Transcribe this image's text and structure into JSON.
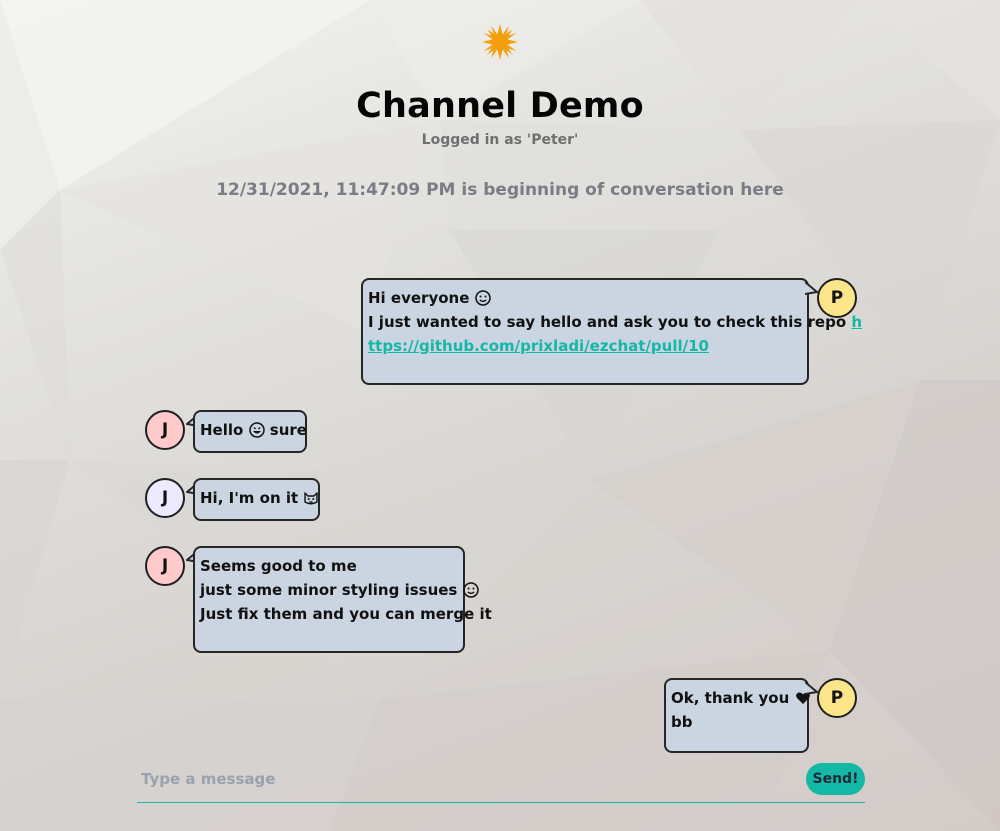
{
  "header": {
    "title": "Channel Demo",
    "logged_in_text": "Logged in as 'Peter'",
    "conversation_start": "12/31/2021, 11:47:09 PM is beginning of conversation here"
  },
  "messages": [
    {
      "side": "right",
      "avatar_initial": "P",
      "avatar_color": "#fde68a",
      "lines": [
        "Hi everyone",
        "I just wanted to say hello and ask you to check this repo",
        "ttps://github.com/prixladi/ezchat/pull/10"
      ],
      "link_prefix": "h",
      "link_text": "ttps://github.com/prixladi/ezchat/pull/10"
    },
    {
      "side": "left",
      "avatar_initial": "J",
      "avatar_color": "#fecaca",
      "lines": [
        "Hello",
        "sure"
      ]
    },
    {
      "side": "left",
      "avatar_initial": "J",
      "avatar_color": "#ede9fe",
      "lines": [
        "Hi, I'm on it"
      ]
    },
    {
      "side": "left",
      "avatar_initial": "J",
      "avatar_color": "#fecaca",
      "lines": [
        "Seems good to me",
        "just some minor styling issues",
        "Just fix them and you can merge it"
      ]
    },
    {
      "side": "right",
      "avatar_initial": "P",
      "avatar_color": "#fde68a",
      "lines": [
        "Ok, thank you",
        "bb"
      ]
    }
  ],
  "composer": {
    "placeholder": "Type a message",
    "send_label": "Send!"
  },
  "colors": {
    "accent": "#14b8a6",
    "bubble": "#cbd5e1",
    "sun": "#f59e0b"
  },
  "icons": {
    "logo": "sun-icon",
    "smile": "slightly-smiling-face-icon",
    "grin": "grinning-face-icon",
    "cat": "cat-face-icon",
    "heart": "black-heart-icon"
  }
}
